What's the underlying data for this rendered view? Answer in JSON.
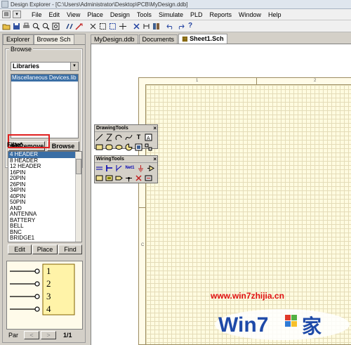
{
  "window": {
    "title": "Design Explorer - [C:\\Users\\Administrator\\Desktop\\PCB\\MyDesign.ddb]"
  },
  "menu": [
    "File",
    "Edit",
    "View",
    "Place",
    "Design",
    "Tools",
    "Simulate",
    "PLD",
    "Reports",
    "Window",
    "Help"
  ],
  "toolbar": {
    "icons": [
      "open-folder-icon",
      "save-icon",
      "print-icon",
      "zoom-in-icon",
      "zoom-out-icon",
      "zoom-fit-icon",
      "cross-probe-icon",
      "wire-icon",
      "cut-icon",
      "select-area-icon",
      "deselect-icon",
      "move-icon",
      "cross-icon",
      "undo-icon",
      "redo-icon",
      "help-icon"
    ]
  },
  "left_panel": {
    "tabs": [
      "Explorer",
      "Browse Sch"
    ],
    "browse": {
      "legend": "Browse",
      "dropdown_value": "Libraries",
      "libraries": [
        "Miscellaneous Devices.lib"
      ],
      "add_remove_button": "dd/Remove",
      "browse_button": "Browse"
    },
    "filter_label": "Filte*",
    "components": [
      "4 HEADER",
      "8 HEADER",
      "12 HEADER",
      "16PIN",
      "20PIN",
      "26PIN",
      "34PIN",
      "40PIN",
      "50PIN",
      "AND",
      "ANTENNA",
      "BATTERY",
      "BELL",
      "BNC",
      "BRIDGE1"
    ],
    "selected_component": "4 HEADER",
    "buttons": {
      "edit": "Edit",
      "place": "Place",
      "find": "Find"
    },
    "preview_pins": [
      "1",
      "2",
      "3",
      "4"
    ],
    "part_label": "Par",
    "part_prev": "<",
    "part_next": ">",
    "part_count": "1/1"
  },
  "doc_tabs": [
    "MyDesign.ddb",
    "Documents",
    "Sheet1.Sch"
  ],
  "sheet": {
    "col_markers": [
      "1",
      "2"
    ],
    "row_marker": "C"
  },
  "drawing_tools": {
    "title": "DrawingTools",
    "close": "×",
    "icons": [
      "line-icon",
      "polygon-icon",
      "arc-icon",
      "bezier-icon",
      "text-icon",
      "text-frame-icon",
      "rectangle-icon",
      "rounded-rect-icon",
      "ellipse-icon",
      "pie-icon",
      "image-icon",
      "array-icon"
    ]
  },
  "wiring_tools": {
    "title": "WiringTools",
    "close": "×",
    "net_label": "Net1",
    "icons": [
      "wire-icon",
      "bus-icon",
      "bus-entry-icon",
      "net-label-icon",
      "power-port-icon",
      "part-icon",
      "sheet-symbol-icon",
      "sheet-entry-icon",
      "port-icon",
      "junction-icon",
      "no-erc-icon",
      "pcb-layout-icon"
    ]
  },
  "watermark": {
    "url": "www.win7zhijia.cn",
    "brand": "Win7",
    "suffix": "家"
  },
  "colors": {
    "selection": "#3a6ea5",
    "highlight_box": "#e02020",
    "sheet": "#fffbe0",
    "watermark": "#e01010"
  }
}
